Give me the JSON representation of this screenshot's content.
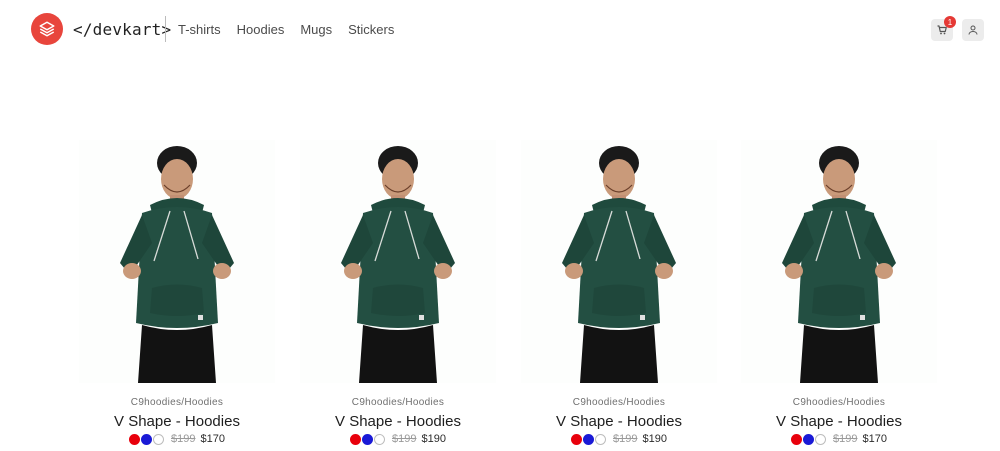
{
  "header": {
    "brand": "</devkart>",
    "logo_icon": "stacked-layers-icon",
    "nav": [
      {
        "label": "T-shirts"
      },
      {
        "label": "Hoodies"
      },
      {
        "label": "Mugs"
      },
      {
        "label": "Stickers"
      }
    ],
    "cart": {
      "icon": "cart-icon",
      "count": "1"
    },
    "account": {
      "icon": "user-icon"
    }
  },
  "colors": {
    "brand_red": "#e8453c",
    "hoodie_green": "#1f4a3d",
    "swatch_red": "#e8000c",
    "swatch_blue": "#1a1ad6",
    "swatch_white": "#ffffff"
  },
  "products": [
    {
      "category": "C9hoodies/Hoodies",
      "title": "V Shape - Hoodies",
      "old_price": "$199",
      "price": "$170",
      "swatches": [
        "red",
        "blue",
        "white"
      ]
    },
    {
      "category": "C9hoodies/Hoodies",
      "title": "V Shape - Hoodies",
      "old_price": "$199",
      "price": "$190",
      "swatches": [
        "red",
        "blue",
        "white"
      ]
    },
    {
      "category": "C9hoodies/Hoodies",
      "title": "V Shape - Hoodies",
      "old_price": "$199",
      "price": "$190",
      "swatches": [
        "red",
        "blue",
        "white"
      ]
    },
    {
      "category": "C9hoodies/Hoodies",
      "title": "V Shape - Hoodies",
      "old_price": "$199",
      "price": "$170",
      "swatches": [
        "red",
        "blue",
        "white"
      ]
    }
  ]
}
